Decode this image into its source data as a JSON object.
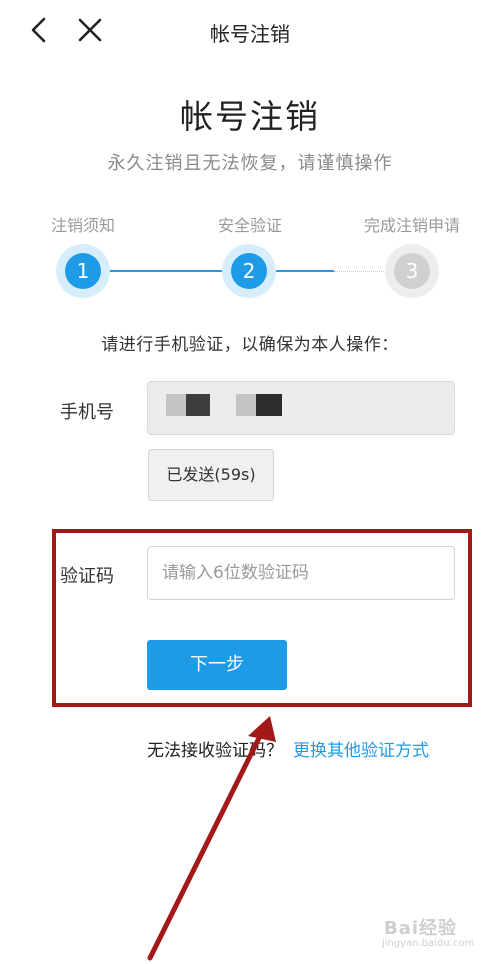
{
  "header": {
    "title": "帐号注销"
  },
  "heading": {
    "title": "帐号注销",
    "subtitle": "永久注销且无法恢复，请谨慎操作"
  },
  "steps": [
    {
      "label": "注销须知",
      "number": "1",
      "status": "done"
    },
    {
      "label": "安全验证",
      "number": "2",
      "status": "active"
    },
    {
      "label": "完成注销申请",
      "number": "3",
      "status": "pending"
    }
  ],
  "instruction": "请进行手机验证，以确保为本人操作：",
  "phone": {
    "label": "手机号"
  },
  "sent_button": {
    "label": "已发送(59s)"
  },
  "code": {
    "label": "验证码",
    "placeholder": "请输入6位数验证码",
    "value": ""
  },
  "next_button": {
    "label": "下一步"
  },
  "help": {
    "text": "无法接收验证码？",
    "link": "更换其他验证方式"
  },
  "watermark": {
    "main": "Bai经验",
    "sub": "jingyan.baidu.com"
  },
  "colors": {
    "accent": "#1e9be6",
    "highlight": "#a31818"
  }
}
